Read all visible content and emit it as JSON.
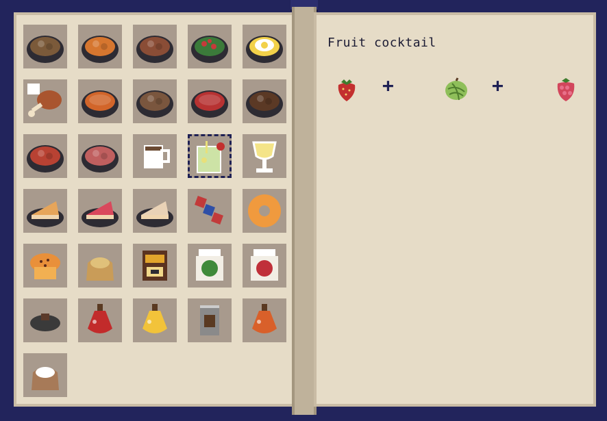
{
  "recipe_book": {
    "selected_item": "fruit-cocktail",
    "items": [
      {
        "id": "bowl-a",
        "icon": "food-bowl-icon",
        "color": "#7b5a3a"
      },
      {
        "id": "bowl-b",
        "icon": "food-bowl-icon",
        "color": "#d6762f"
      },
      {
        "id": "bowl-c",
        "icon": "food-bowl-icon",
        "color": "#8a4d36"
      },
      {
        "id": "bowl-d",
        "icon": "salad-bowl-icon",
        "color": "#3b7a3a"
      },
      {
        "id": "bowl-e",
        "icon": "egg-bowl-icon",
        "color": "#f2d14a"
      },
      {
        "id": "drumstick",
        "icon": "drumstick-icon",
        "color": "#a9552f"
      },
      {
        "id": "soup-orange",
        "icon": "soup-bowl-icon",
        "color": "#d2652a"
      },
      {
        "id": "bowl-f",
        "icon": "food-bowl-icon",
        "color": "#7a563e"
      },
      {
        "id": "soup-red",
        "icon": "soup-bowl-icon",
        "color": "#b73232"
      },
      {
        "id": "bowl-g",
        "icon": "food-bowl-icon",
        "color": "#5b3925"
      },
      {
        "id": "bowl-h",
        "icon": "food-bowl-icon",
        "color": "#b84233"
      },
      {
        "id": "bowl-i",
        "icon": "food-bowl-icon",
        "color": "#c05f5f"
      },
      {
        "id": "coffee-mug",
        "icon": "mug-icon",
        "color": "#ffffff"
      },
      {
        "id": "fruit-cocktail",
        "icon": "cocktail-glass-icon",
        "color": "#cde3a6"
      },
      {
        "id": "lemonade",
        "icon": "goblet-icon",
        "color": "#f4e488"
      },
      {
        "id": "cake-slice-a",
        "icon": "cake-slice-icon",
        "color": "#e6a55a"
      },
      {
        "id": "cake-slice-b",
        "icon": "cake-slice-icon",
        "color": "#d9485c"
      },
      {
        "id": "cake-slice-c",
        "icon": "cake-slice-icon",
        "color": "#e9d2b6"
      },
      {
        "id": "skewer",
        "icon": "skewer-icon",
        "color": "#c23a3a"
      },
      {
        "id": "donut",
        "icon": "donut-icon",
        "color": "#f09a3e"
      },
      {
        "id": "muffin",
        "icon": "muffin-icon",
        "color": "#e9903a"
      },
      {
        "id": "flour-sack",
        "icon": "sack-icon",
        "color": "#c99c58"
      },
      {
        "id": "honey-jar",
        "icon": "honey-jar-icon",
        "color": "#e3a52c"
      },
      {
        "id": "jar-green",
        "icon": "jar-icon",
        "color": "#3f8a3a"
      },
      {
        "id": "jar-red",
        "icon": "jar-icon",
        "color": "#c0303a"
      },
      {
        "id": "coal",
        "icon": "coal-icon",
        "color": "#3a3a3a"
      },
      {
        "id": "red-potion",
        "icon": "potion-icon",
        "color": "#c22b2b"
      },
      {
        "id": "yellow-potion",
        "icon": "potion-icon",
        "color": "#f2c33a"
      },
      {
        "id": "can",
        "icon": "can-icon",
        "color": "#8a8a8a"
      },
      {
        "id": "orange-potion",
        "icon": "potion-icon",
        "color": "#d9602a"
      },
      {
        "id": "sugar-sack",
        "icon": "sack-icon",
        "color": "#a77a58"
      }
    ]
  },
  "recipe": {
    "title": "Fruit cocktail",
    "ingredients": [
      {
        "icon": "strawberry-icon",
        "color": "#c3302f"
      },
      {
        "icon": "gooseberry-icon",
        "color": "#8fbf5a"
      },
      {
        "icon": "raspberry-icon",
        "color": "#d2465c"
      }
    ],
    "operator": "+"
  }
}
